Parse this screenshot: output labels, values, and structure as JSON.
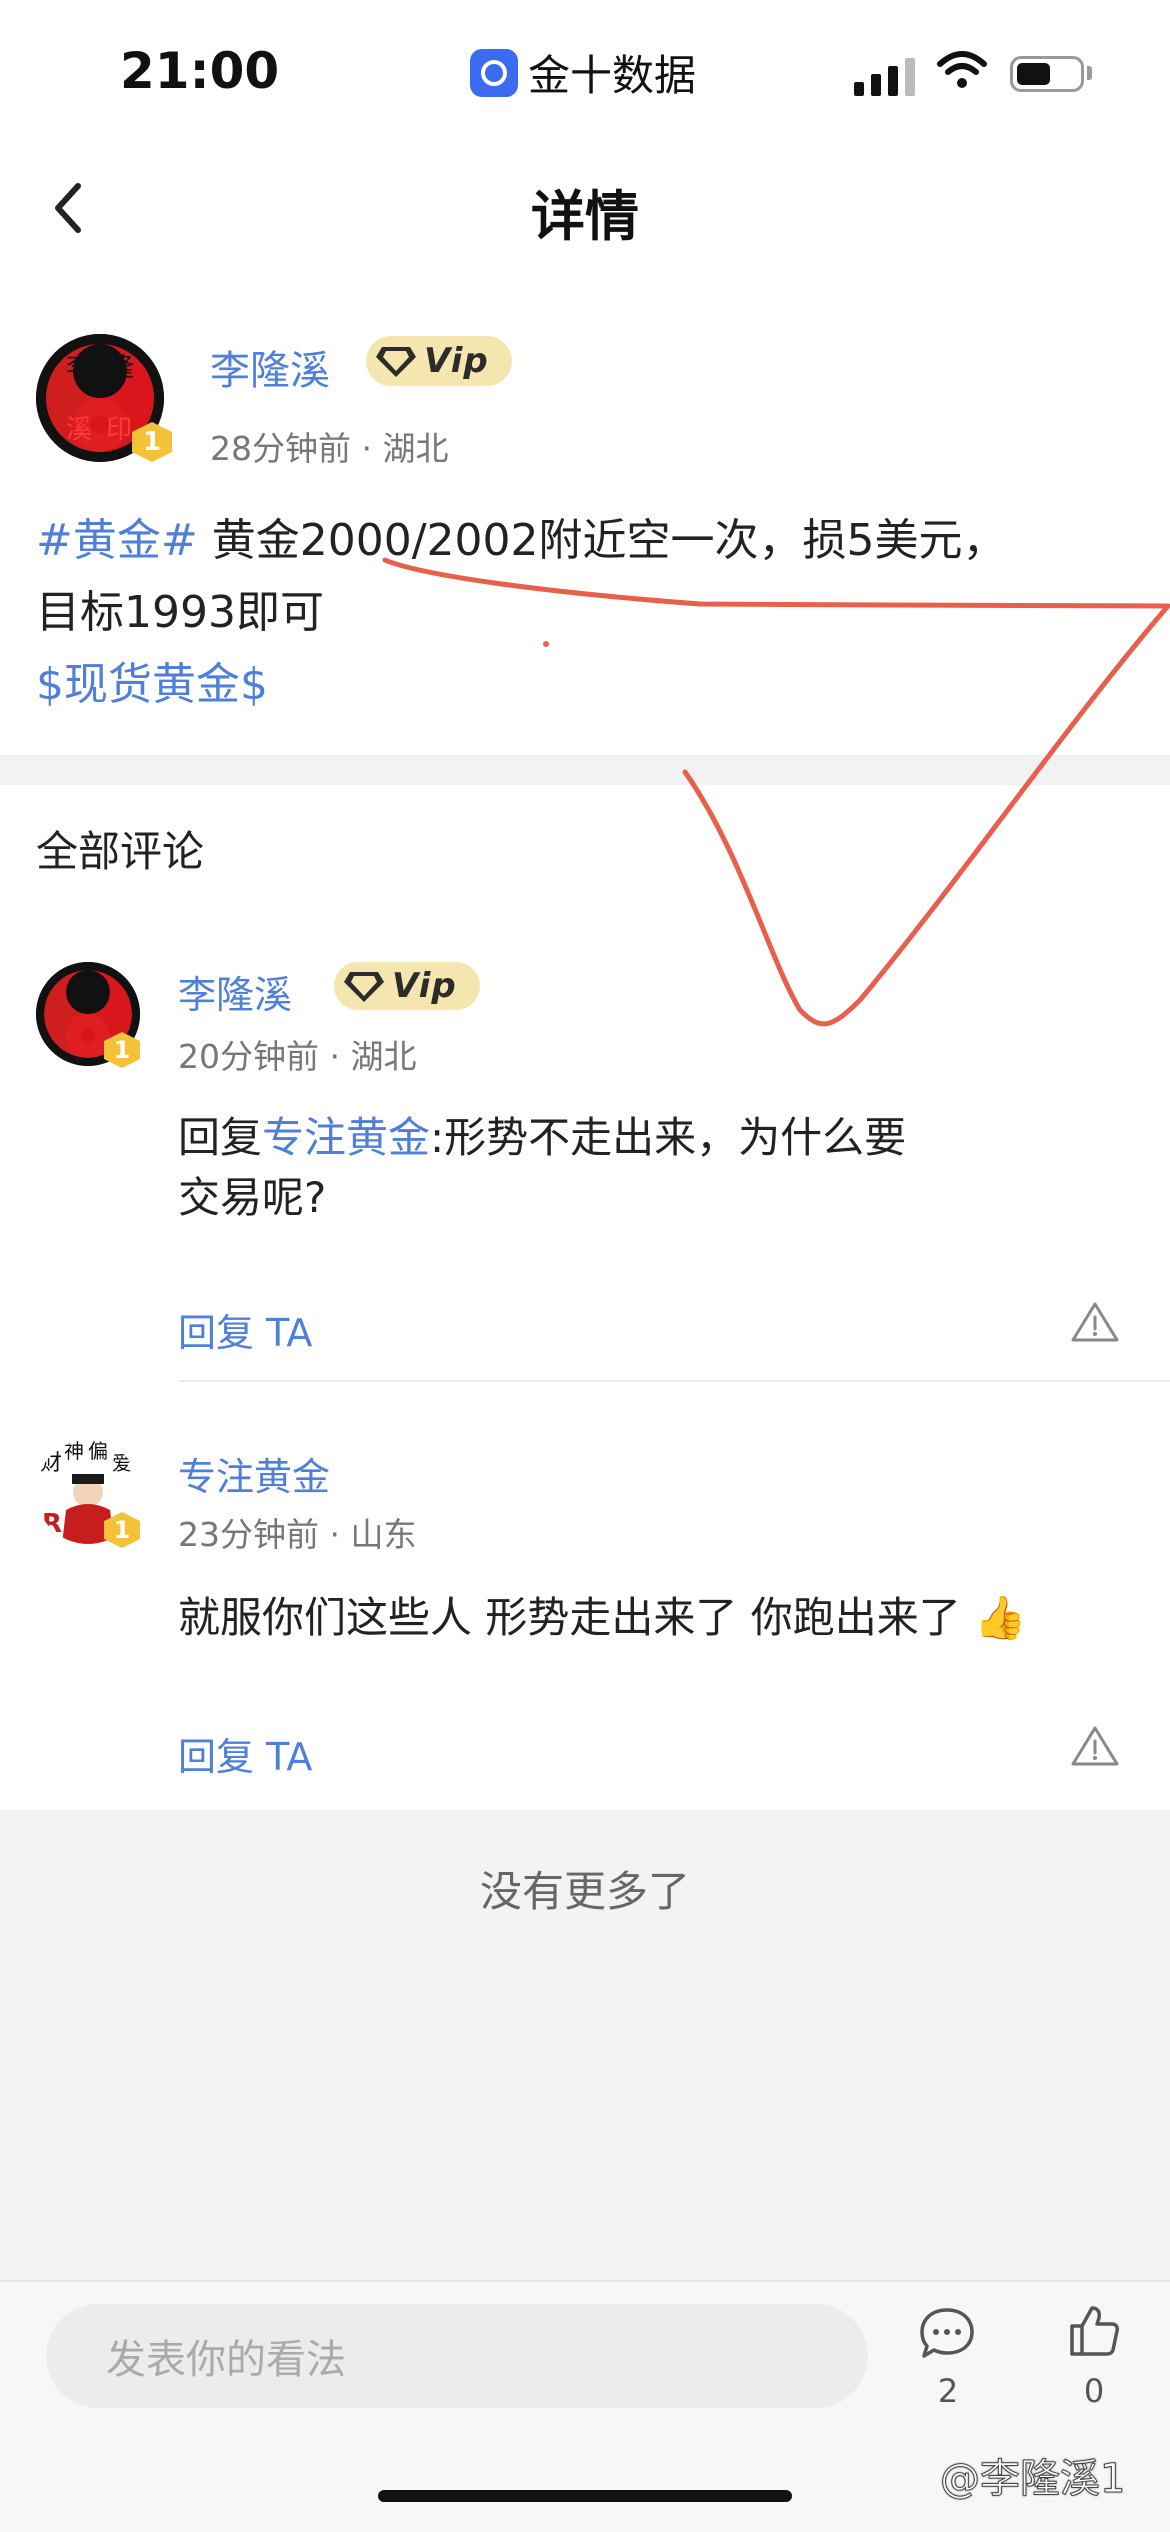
{
  "status_bar": {
    "time": "21:00",
    "app_name": "金十数据"
  },
  "header": {
    "title": "详情"
  },
  "post": {
    "author": "李隆溪",
    "avatar_text": [
      "李",
      "隆",
      "溪",
      "印"
    ],
    "level": "1",
    "vip_label": "Vip",
    "time": "28分钟前",
    "location": "湖北",
    "topic_tag": "#黄金#",
    "body_line1": " 黄金2000/2002附近空一次，损5美元，",
    "body_line2": "目标1993即可",
    "stock_tag": "$现货黄金$"
  },
  "comments_section": {
    "title": "全部评论",
    "items": [
      {
        "author": "李隆溪",
        "level": "1",
        "vip_label": "Vip",
        "time": "20分钟前",
        "location": "湖北",
        "reply_prefix": "回复",
        "reply_to": "专注黄金",
        "text_line1": ":形势不走出来，为什么要",
        "text_line2": "交易呢?",
        "reply_label": "回复 TA"
      },
      {
        "author": "专注黄金",
        "level": "1",
        "avatar_text": "财神偏爱",
        "time": "23分钟前",
        "location": "山东",
        "text": "就服你们这些人 形势走出来了 你跑出来了 👍",
        "reply_label": "回复 TA"
      }
    ],
    "no_more": "没有更多了"
  },
  "toolbar": {
    "input_placeholder": "发表你的看法",
    "comment_count": "2",
    "like_count": "0"
  },
  "watermark": "@李隆溪1",
  "colors": {
    "link": "#4f7fd8",
    "annotation": "#e8604c",
    "vip_bg": "#f5e6b0",
    "level_badge": "#f3c238"
  }
}
